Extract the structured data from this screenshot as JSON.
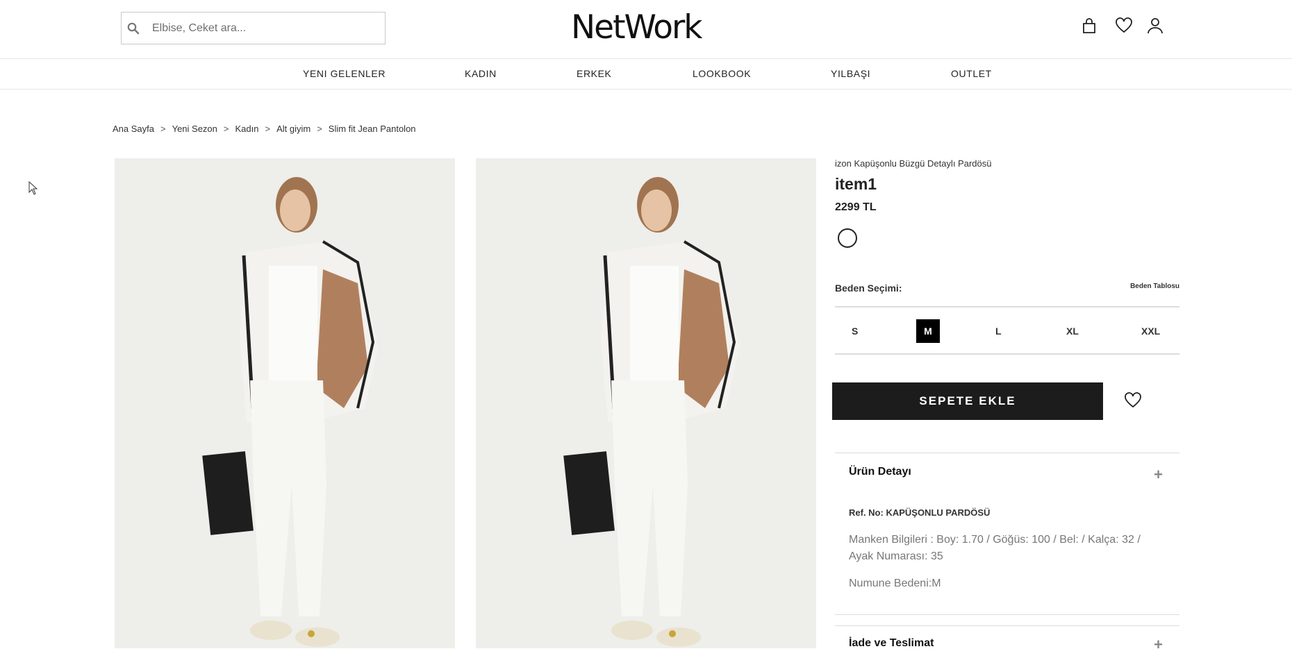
{
  "header": {
    "search_placeholder": "Elbise, Ceket ara...",
    "logo": "NetWork",
    "icons": [
      "bag-icon",
      "heart-icon",
      "user-icon"
    ]
  },
  "nav": [
    "YENI GELENLER",
    "KADIN",
    "ERKEK",
    "LOOKBOOK",
    "YILBAŞI",
    "OUTLET"
  ],
  "breadcrumb": [
    "Ana Sayfa",
    "Yeni Sezon",
    "Kadın",
    "Alt giyim",
    "Slim fit Jean Pantolon"
  ],
  "product": {
    "subtitle": "izon Kapüşonlu Büzgü Detaylı Pardösü",
    "title": "item1",
    "price": "2299 TL",
    "size_label": "Beden Seçimi:",
    "size_table": "Beden Tablosu",
    "sizes": [
      "S",
      "M",
      "L",
      "XL",
      "XXL"
    ],
    "selected_size": "M",
    "add_to_cart": "SEPETE EKLE"
  },
  "details": {
    "title": "Ürün Detayı",
    "ref": "Ref. No: KAPÜŞONLU PARDÖSÜ",
    "model_info": "Manken Bilgileri : Boy: 1.70 / Göğüs: 100 / Bel: / Kalça: 32 / Ayak Numarası: 35",
    "sample_size": "Numune Bedeni:M"
  },
  "returns": {
    "title": "İade ve Teslimat"
  },
  "colors": {
    "accent": "#1c1c1c",
    "photo_bg": "#eeeeea"
  }
}
